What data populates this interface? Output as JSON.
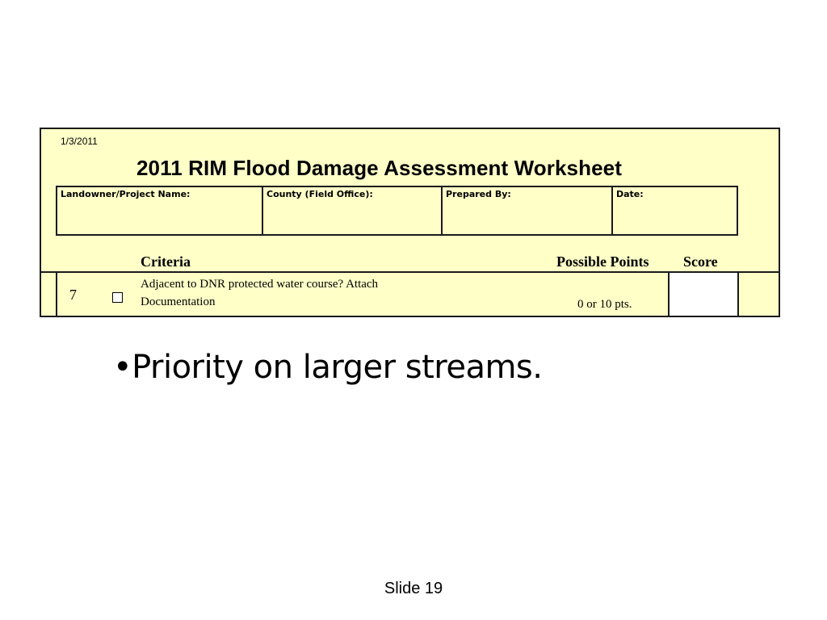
{
  "worksheet": {
    "date": "1/3/2011",
    "title": "2011 RIM Flood Damage Assessment Worksheet",
    "fields": {
      "landowner": "Landowner/Project Name:",
      "county": "County (Field Office):",
      "prepared_by": "Prepared By:",
      "date": "Date:"
    },
    "headers": {
      "criteria": "Criteria",
      "possible_points": "Possible Points",
      "score": "Score"
    },
    "rows": [
      {
        "number": "7",
        "text_line1": "Adjacent to DNR protected water course?  Attach",
        "text_line2": "Documentation",
        "points": "0 or 10 pts.",
        "checked": false
      }
    ]
  },
  "bullet": "•Priority on larger streams.",
  "footer": "Slide 19",
  "colors": {
    "worksheet_background": "#ffffc8",
    "border": "#1a1a1a"
  }
}
